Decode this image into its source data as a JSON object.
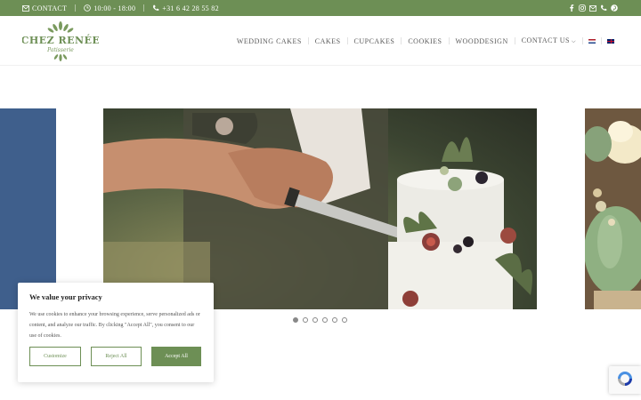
{
  "topbar": {
    "contact_label": "CONTACT",
    "hours": "10:00 - 18:00",
    "phone": "+31 6 42 28 55 82",
    "social_icons": [
      "facebook-icon",
      "instagram-icon",
      "mail-icon",
      "phone-icon",
      "pinterest-icon"
    ]
  },
  "logo": {
    "name": "CHEZ RENÉE",
    "tagline": "Patisserie"
  },
  "nav": {
    "items": [
      "WEDDING CAKES",
      "CAKES",
      "CUPCAKES",
      "COOKIES",
      "WOODDESIGN",
      "CONTACT US"
    ],
    "languages": [
      "nl-flag",
      "en-flag"
    ]
  },
  "slider": {
    "dot_count": 6,
    "active_index": 0
  },
  "cookie": {
    "title": "We value your privacy",
    "text": "We use cookies to enhance your browsing experience, serve personalized ads or content, and analyze our traffic. By clicking \"Accept All\", you consent to our use of cookies.",
    "customize": "Customize",
    "reject": "Reject All",
    "accept": "Accept All"
  },
  "colors": {
    "brand_green": "#6d8f55",
    "slide_blue": "#3f5f8c"
  }
}
